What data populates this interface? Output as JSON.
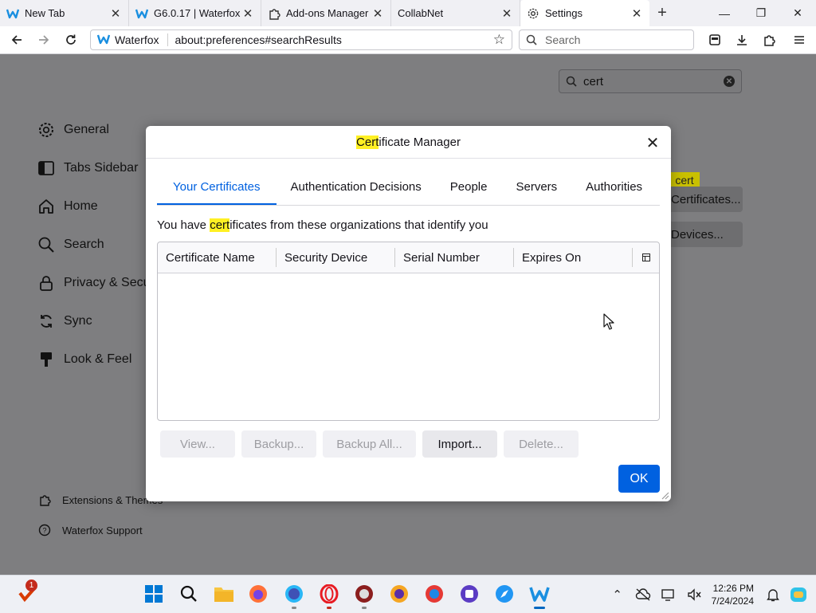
{
  "tabs": [
    {
      "title": "New Tab"
    },
    {
      "title": "G6.0.17 | Waterfox"
    },
    {
      "title": "Add-ons Manager"
    },
    {
      "title": "CollabNet"
    },
    {
      "title": "Settings"
    }
  ],
  "navbar": {
    "brand": "Waterfox",
    "url": "about:preferences#searchResults",
    "search_placeholder": "Search"
  },
  "prefs": {
    "find_value": "cert",
    "categories": [
      "General",
      "Tabs Sidebar",
      "Home",
      "Search",
      "Privacy & Security",
      "Sync",
      "Look & Feel"
    ],
    "footer_links": [
      "Extensions & Themes",
      "Waterfox Support"
    ],
    "background_highlight": "cert",
    "background_buttons": [
      "Certificates...",
      "Devices..."
    ]
  },
  "dialog": {
    "title_highlight": "Cert",
    "title_rest": "ificate Manager",
    "tabs": [
      "Your Certificates",
      "Authentication Decisions",
      "People",
      "Servers",
      "Authorities"
    ],
    "selected_tab": 0,
    "desc_before": "You have ",
    "desc_highlight": "cert",
    "desc_after": "ificates from these organizations that identify you",
    "columns": [
      "Certificate Name",
      "Security Device",
      "Serial Number",
      "Expires On"
    ],
    "buttons": [
      {
        "label": "View...",
        "enabled": false
      },
      {
        "label": "Backup...",
        "enabled": false
      },
      {
        "label": "Backup All...",
        "enabled": false
      },
      {
        "label": "Import...",
        "enabled": true
      },
      {
        "label": "Delete...",
        "enabled": false
      }
    ],
    "ok_label": "OK"
  },
  "taskbar": {
    "notification_badge": "1",
    "time": "12:26 PM",
    "date": "7/24/2024"
  },
  "colors": {
    "accent": "#0061e0",
    "highlight": "#fff023",
    "overlay_bg": "#7e7e80"
  }
}
